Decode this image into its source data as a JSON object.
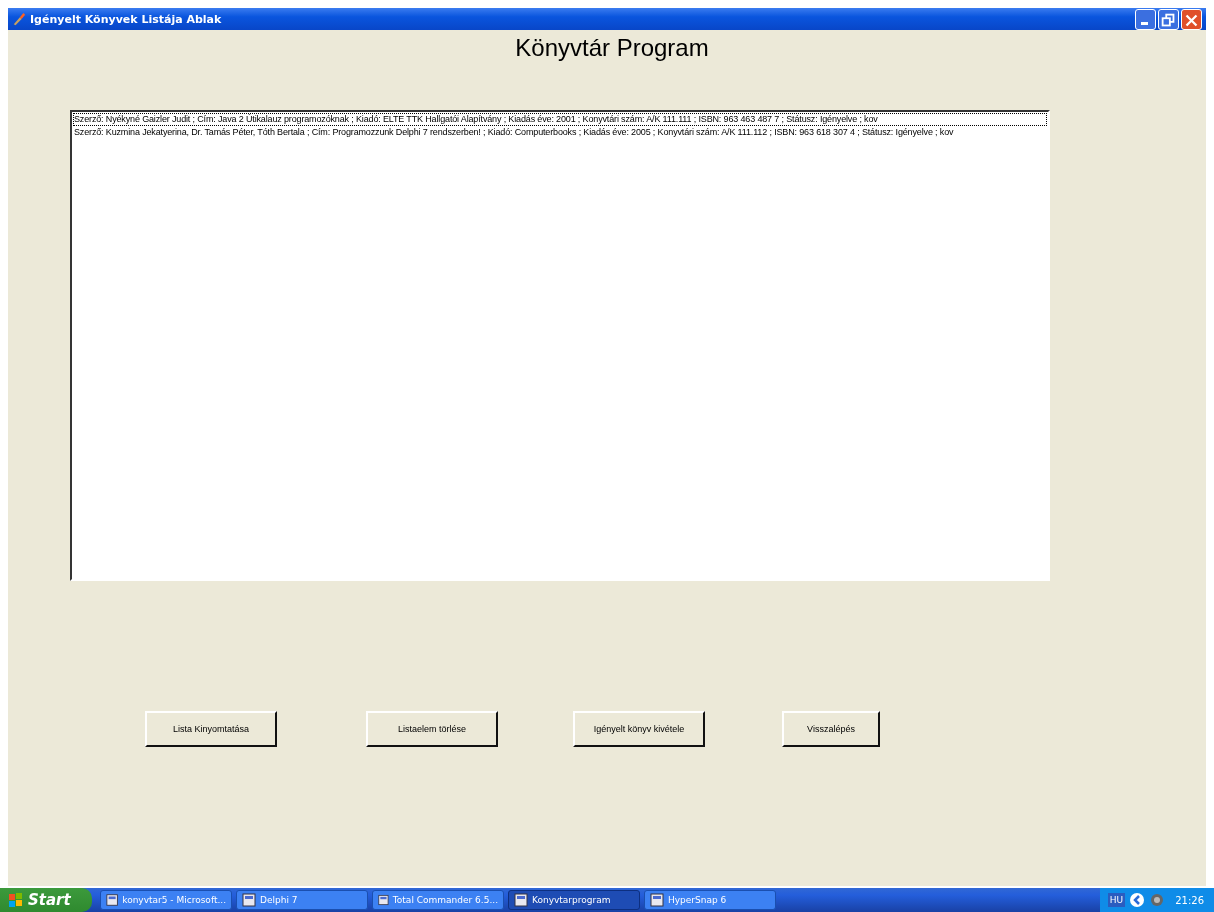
{
  "window": {
    "title": "Igényelt Könyvek Listája Ablak"
  },
  "heading": "Könyvtár Program",
  "list": {
    "items": [
      {
        "text": "Szerző: Nyékyné Gaizler Judit ; Cím: Java 2 Útikalauz programozóknak ; Kiadó: ELTE TTK Hallgatói Alapítvány ; Kiadás éve: 2001 ; Konyvtári szám: A/K 111.111 ; ISBN: 963 463 487 7 ; Státusz: Igényelve ; kov",
        "selected": true
      },
      {
        "text": "Szerző: Kuzmina Jekatyerina, Dr. Tamás Péter, Tóth Bertala ; Cím: Programozzunk Delphi 7 rendszerben! ; Kiadó: Computerbooks ; Kiadás éve: 2005 ; Konyvtári szám: A/K 111.112 ; ISBN: 963 618 307 4 ; Státusz: Igényelve ; kov",
        "selected": false
      }
    ]
  },
  "buttons": [
    "Lista Kinyomtatása",
    "Listaelem törlése",
    "Igényelt könyv kivétele",
    "Visszalépés"
  ],
  "taskbar": {
    "start": "Start",
    "tasks": [
      {
        "label": "konyvtar5 - Microsoft...",
        "selected": false
      },
      {
        "label": "Delphi 7",
        "selected": false
      },
      {
        "label": "Total Commander 6.5...",
        "selected": false
      },
      {
        "label": "Konyvtarprogram",
        "selected": true
      },
      {
        "label": "HyperSnap 6",
        "selected": false
      }
    ],
    "language": "HU",
    "clock": "21:26"
  }
}
